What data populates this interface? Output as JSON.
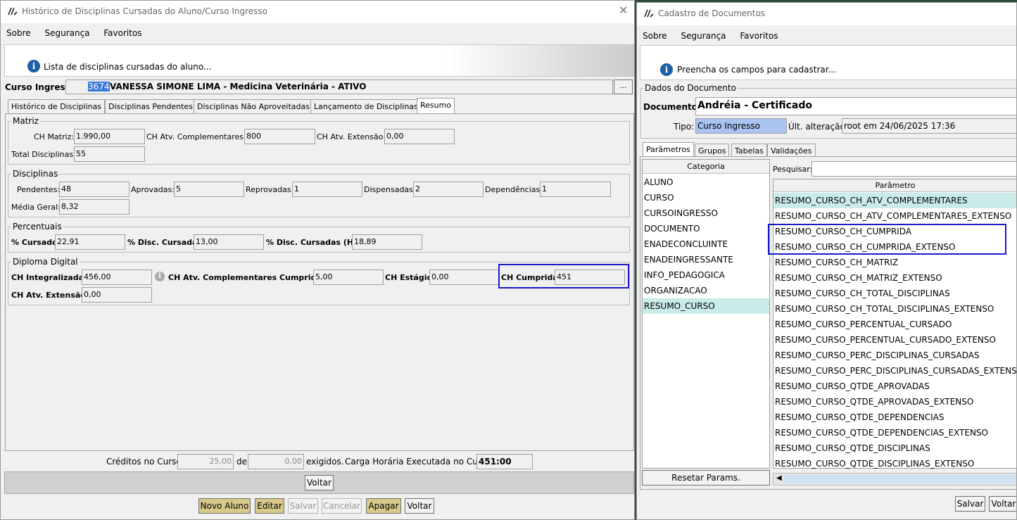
{
  "left_window": {
    "title": "Histórico de Disciplinas Cursadas do Aluno/Curso Ingresso",
    "menu": [
      "Sobre",
      "Segurança",
      "Favoritos"
    ],
    "info": "Lista de disciplinas cursadas do aluno...",
    "curso_label": "Curso Ingresso:",
    "curso_id": "3674",
    "curso_text": "VANESSA SIMONE LIMA - Medicina Veterinária - ATIVO",
    "ellipsis": "...",
    "tabs": [
      "Histórico de Disciplinas",
      "Disciplinas Pendentes",
      "Disciplinas Não Aproveitadas",
      "Lançamento de Disciplinas",
      "Resumo"
    ],
    "matriz": {
      "title": "Matriz",
      "ch_label": "CH Matriz:",
      "ch": "1.990,00",
      "compl_label": "CH Atv. Complementares:",
      "compl": "800",
      "ext_label": "CH Atv. Extensão:",
      "ext": "0,00",
      "total_label": "Total Disciplinas:",
      "total": "55"
    },
    "disciplinas": {
      "title": "Disciplinas",
      "pend_label": "Pendentes:",
      "pend": "48",
      "aprov_label": "Aprovadas:",
      "aprov": "5",
      "reprov_label": "Reprovadas:",
      "reprov": "1",
      "disp_label": "Dispensadas:",
      "disp": "2",
      "dep_label": "Dependências:",
      "dep": "1",
      "media_label": "Média Geral:",
      "media": "8,32"
    },
    "percentuais": {
      "title": "Percentuais",
      "cursado_label": "% Cursado:",
      "cursado": "22,91",
      "disc_label": "% Disc. Cursadas:",
      "disc": "13,00",
      "disc_hr_label": "% Disc. Cursadas (HR):",
      "disc_hr": "18,89"
    },
    "diploma": {
      "title": "Diploma Digital",
      "integ_label": "CH Integralizada:",
      "integ": "456,00",
      "compl_label": "CH Atv. Complementares Cumpridas:",
      "compl": "5,00",
      "estagio_label": "CH Estágio:",
      "estagio": "0,00",
      "cumprida_label": "CH Cumprida:",
      "cumprida": "451",
      "ext_label": "CH Atv. Extensão:",
      "ext": "0,00"
    },
    "footer": {
      "creditos_label": "Créditos no Curso:",
      "creditos": "25,00",
      "de": "de",
      "exigidos_val": "0,00",
      "exigidos": "exigidos.",
      "carga_label": "Carga Horária Executada no Curso:",
      "carga": "451:00"
    },
    "voltar": "Voltar",
    "buttons": [
      "Novo Aluno",
      "Editar",
      "Salvar",
      "Cancelar",
      "Apagar",
      "Voltar"
    ]
  },
  "right_window": {
    "title": "Cadastro de Documentos",
    "menu": [
      "Sobre",
      "Segurança",
      "Favoritos"
    ],
    "info": "Preencha os campos para cadastrar...",
    "group_title": "Dados do Documento",
    "doc_label": "Documento:",
    "doc": "Andréia - Certificado",
    "tipo_label": "Tipo:",
    "tipo": "Curso Ingresso",
    "ult_label": "Últ. alteração:",
    "ult": "root em 24/06/2025 17:36",
    "tabs": [
      "Parâmetros",
      "Grupos",
      "Tabelas",
      "Validações"
    ],
    "categoria_header": "Categoria",
    "categorias": [
      "ALUNO",
      "CURSO",
      "CURSOINGRESSO",
      "DOCUMENTO",
      "ENADECONCLUINTE",
      "ENADEINGRESSANTE",
      "INFO_PEDAGOGICA",
      "ORGANIZACAO",
      "RESUMO_CURSO"
    ],
    "pesquisar_label": "Pesquisar:",
    "parametro_header": "Parâmetro",
    "parametros": [
      "RESUMO_CURSO_CH_ATV_COMPLEMENTARES",
      "RESUMO_CURSO_CH_ATV_COMPLEMENTARES_EXTENSO",
      "RESUMO_CURSO_CH_CUMPRIDA",
      "RESUMO_CURSO_CH_CUMPRIDA_EXTENSO",
      "RESUMO_CURSO_CH_MATRIZ",
      "RESUMO_CURSO_CH_MATRIZ_EXTENSO",
      "RESUMO_CURSO_CH_TOTAL_DISCIPLINAS",
      "RESUMO_CURSO_CH_TOTAL_DISCIPLINAS_EXTENSO",
      "RESUMO_CURSO_PERCENTUAL_CURSADO",
      "RESUMO_CURSO_PERCENTUAL_CURSADO_EXTENSO",
      "RESUMO_CURSO_PERC_DISCIPLINAS_CURSADAS",
      "RESUMO_CURSO_PERC_DISCIPLINAS_CURSADAS_EXTENSO",
      "RESUMO_CURSO_QTDE_APROVADAS",
      "RESUMO_CURSO_QTDE_APROVADAS_EXTENSO",
      "RESUMO_CURSO_QTDE_DEPENDENCIAS",
      "RESUMO_CURSO_QTDE_DEPENDENCIAS_EXTENSO",
      "RESUMO_CURSO_QTDE_DISCIPLINAS",
      "RESUMO_CURSO_QTDE_DISCIPLINAS_EXTENSO"
    ],
    "resetar": "Resetar Params.",
    "salvar": "Salvar",
    "voltar": "Voltar"
  }
}
